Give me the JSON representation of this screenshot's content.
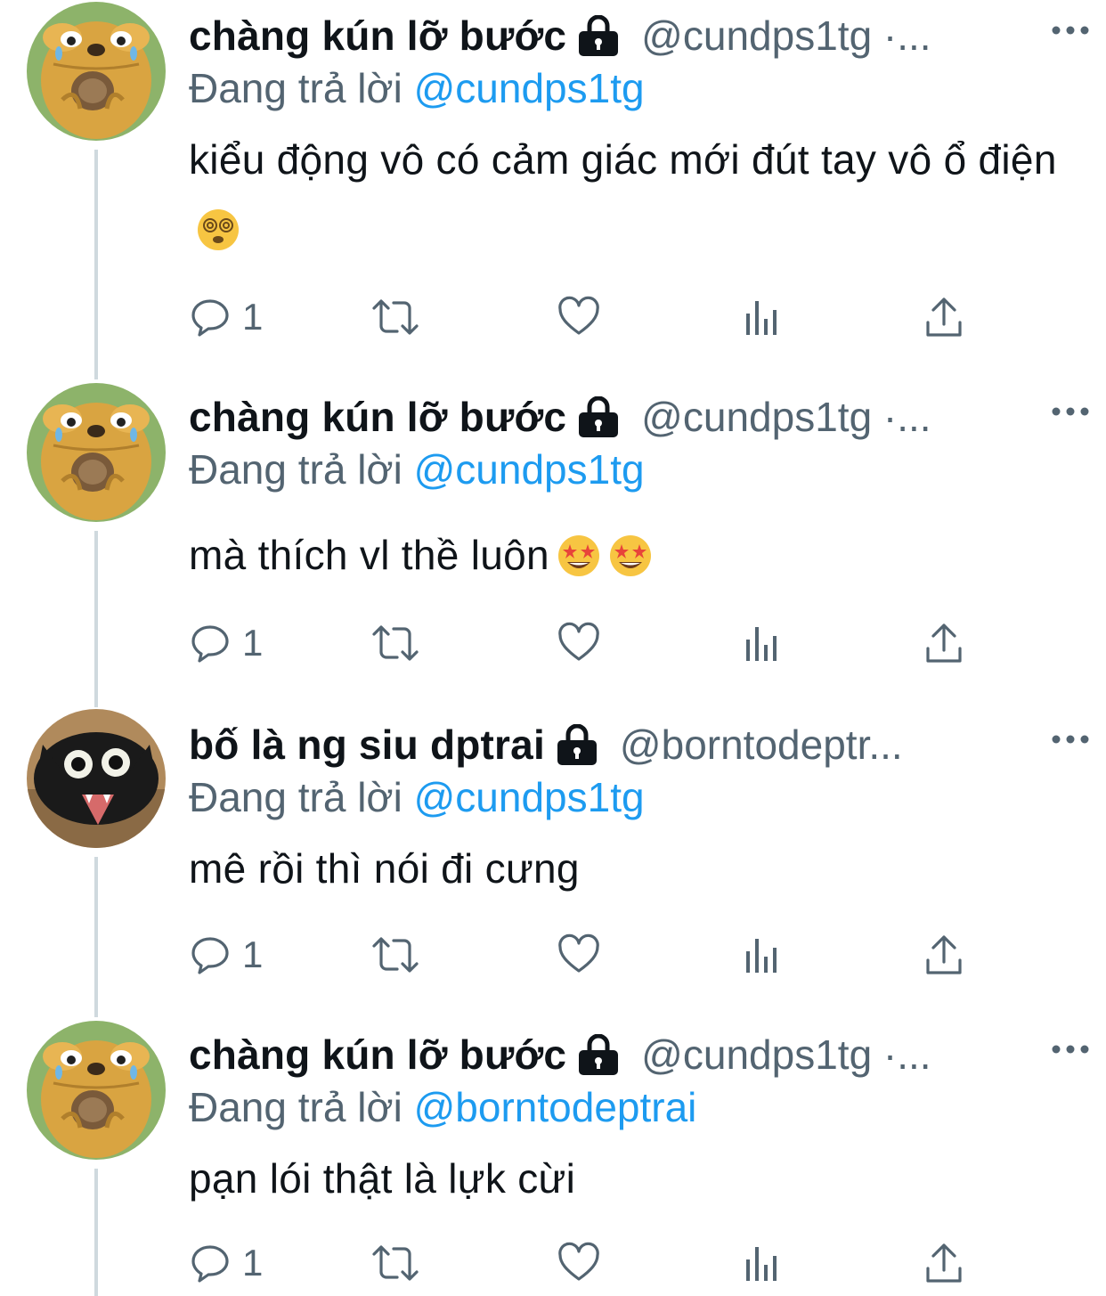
{
  "tweets": [
    {
      "name": "chàng kún lỡ bước",
      "handle": "@cundps1tg ·...",
      "reply_prefix": "Đang trả lời",
      "reply_to": "@cundps1tg",
      "text": "kiểu động vô có cảm giác mới đút tay vô ổ điện",
      "emojis": [
        "dizzy-face-emoji"
      ],
      "reply_count": "1",
      "avatar": "cartoon-dog-avatar"
    },
    {
      "name": "chàng kún lỡ bước",
      "handle": "@cundps1tg ·...",
      "reply_prefix": "Đang trả lời",
      "reply_to": "@cundps1tg",
      "text": "mà thích vl thề luôn",
      "emojis": [
        "star-struck-emoji",
        "star-struck-emoji"
      ],
      "reply_count": "1",
      "avatar": "cartoon-dog-avatar"
    },
    {
      "name": "bố là ng siu dptrai",
      "handle": "@borntodeptr...",
      "reply_prefix": "Đang trả lời",
      "reply_to": "@cundps1tg",
      "text": "mê rồi thì nói đi cưng",
      "emojis": [],
      "reply_count": "1",
      "avatar": "black-cat-avatar"
    },
    {
      "name": "chàng kún lỡ bước",
      "handle": "@cundps1tg ·...",
      "reply_prefix": "Đang trả lời",
      "reply_to": "@borntodeptrai",
      "text": "pạn lói thật là lựk cừi",
      "emojis": [],
      "reply_count": "1",
      "avatar": "cartoon-dog-avatar"
    }
  ],
  "colors": {
    "text": "#0f1419",
    "secondary": "#536471",
    "link": "#1d9bf0",
    "thread_line": "#cfd9de"
  }
}
